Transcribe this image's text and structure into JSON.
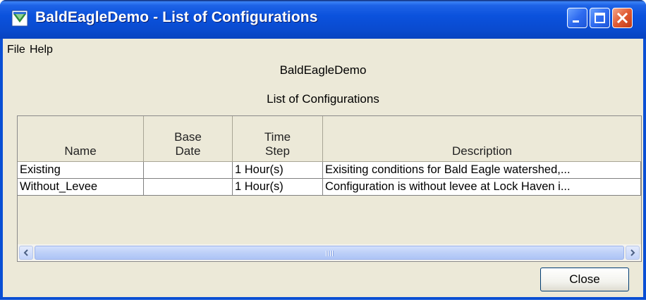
{
  "window": {
    "title": "BaldEagleDemo - List of Configurations"
  },
  "menu": {
    "file": "File",
    "help": "Help"
  },
  "headings": {
    "project": "BaldEagleDemo",
    "subtitle": "List of Configurations"
  },
  "table": {
    "columns": [
      {
        "line1": "",
        "line2": "Name"
      },
      {
        "line1": "Base",
        "line2": "Date"
      },
      {
        "line1": "Time",
        "line2": "Step"
      },
      {
        "line1": "",
        "line2": "Description"
      }
    ],
    "rows": [
      {
        "name": "Existing",
        "base_date": "",
        "time_step": "1 Hour(s)",
        "description": "Exisiting conditions for Bald Eagle watershed,..."
      },
      {
        "name": "Without_Levee",
        "base_date": "",
        "time_step": "1 Hour(s)",
        "description": "Configuration is without levee at Lock Haven i..."
      }
    ]
  },
  "buttons": {
    "close": "Close"
  },
  "colors": {
    "titlebar": "#0a4fd4",
    "window_bg": "#ece9d8",
    "close_button_red": "#e15a32"
  }
}
